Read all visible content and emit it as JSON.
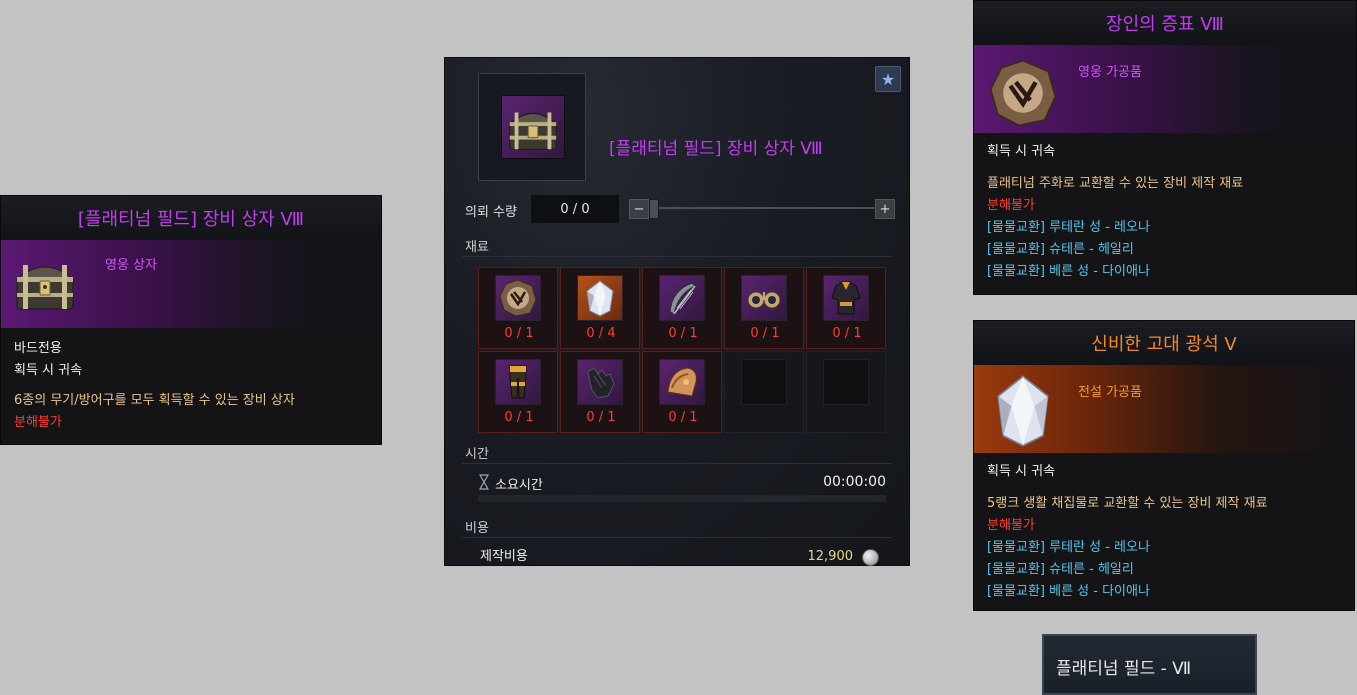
{
  "item_tooltip": {
    "title": "[플래티넘 필드] 장비 상자 Ⅷ",
    "grade": "영웅 상자",
    "icon": "treasure-chest-icon",
    "lines": [
      "바드전용",
      "획득 시 귀속"
    ],
    "description": "6종의 무기/방어구를 모두 획득할 수 있는 장비 상자",
    "disassemble": "분해불가"
  },
  "craft": {
    "item_name": "[플래티넘 필드] 장비 상자 Ⅷ",
    "favorite_icon": "star-icon",
    "quantity_label": "의뢰 수량",
    "quantity_value": "0 / 0",
    "minus": "−",
    "plus": "+",
    "materials_label": "재료",
    "materials": [
      {
        "icon": "proof-medal-icon",
        "count": "0 / 1",
        "bg": "purple"
      },
      {
        "icon": "ore-crystal-icon",
        "count": "0 / 4",
        "bg": "orange"
      },
      {
        "icon": "harp-icon",
        "count": "0 / 1",
        "bg": "purple"
      },
      {
        "icon": "earring-icon",
        "count": "0 / 1",
        "bg": "purple"
      },
      {
        "icon": "chest-armor-icon",
        "count": "0 / 1",
        "bg": "purple"
      },
      {
        "icon": "leg-armor-icon",
        "count": "0 / 1",
        "bg": "purple"
      },
      {
        "icon": "gloves-icon",
        "count": "0 / 1",
        "bg": "purple"
      },
      {
        "icon": "shoulder-armor-icon",
        "count": "0 / 1",
        "bg": "purple"
      }
    ],
    "time_label": "시간",
    "time_row_label": "소요시간",
    "time_value": "00:00:00",
    "cost_label": "비용",
    "cost_row_label": "제작비용",
    "cost_value": "12,900"
  },
  "proof_tooltip": {
    "title": "장인의 증표 Ⅷ",
    "grade": "영웅 가공품",
    "bind": "획득 시 귀속",
    "description": "플래티넘 주화로 교환할 수 있는 장비 제작 재료",
    "disassemble": "분해불가",
    "exchanges": [
      "[물물교환] 루테란 성 - 레오나",
      "[물물교환] 슈테른 - 헤일리",
      "[물물교환] 베른 성 - 다이애나"
    ]
  },
  "ore_tooltip": {
    "title": "신비한 고대 광석 Ⅴ",
    "grade": "전설 가공품",
    "bind": "획득 시 귀속",
    "description": "5랭크 생활 채집물로 교환할 수 있는 장비 제작 재료",
    "disassemble": "분해불가",
    "exchanges": [
      "[물물교환] 루테란 성 - 레오나",
      "[물물교환] 슈테른 - 헤일리",
      "[물물교환] 베른 성 - 다이애나"
    ]
  },
  "field_label": "플래티넘 필드 - Ⅶ",
  "colors": {
    "hero": "#c23df0",
    "legend": "#f08a2c",
    "red": "#ff3b30",
    "cyan": "#53c6ee",
    "gold": "#e9c48a"
  }
}
